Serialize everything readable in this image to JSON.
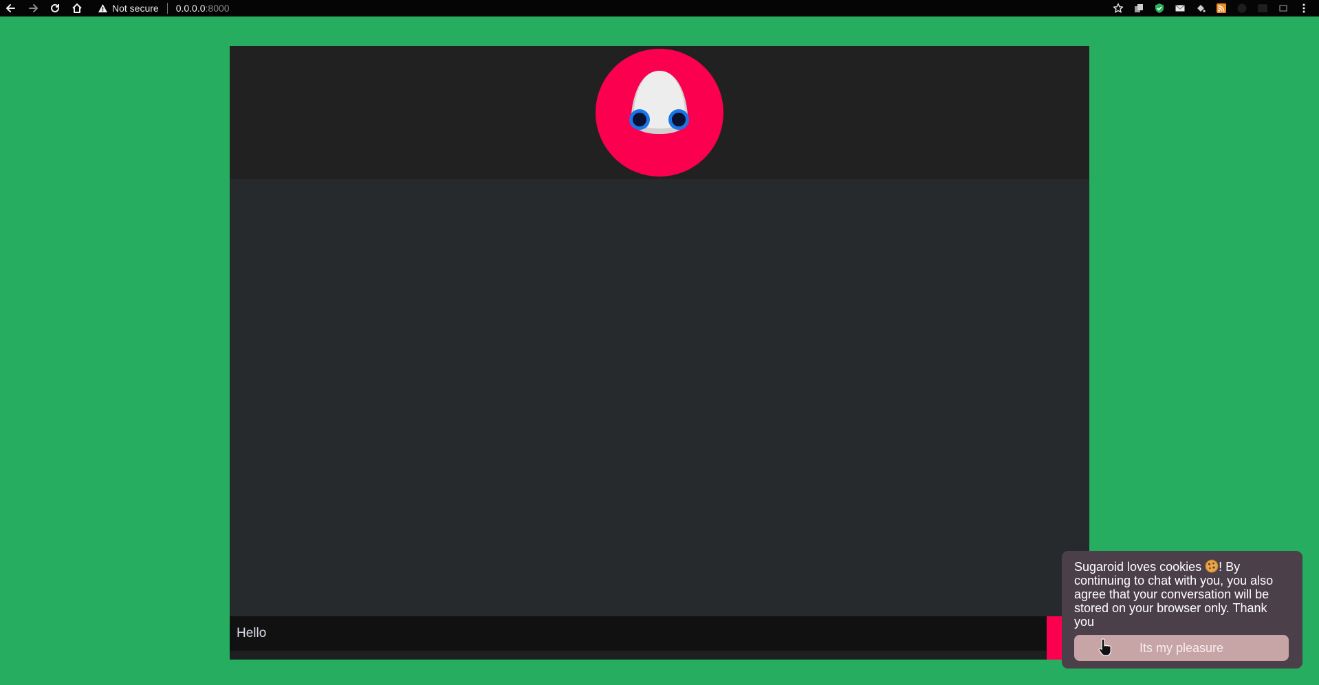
{
  "browser": {
    "security_label": "Not secure",
    "url_host": "0.0.0.0",
    "url_port": ":8000",
    "icons": {
      "back": "arrow-left-icon",
      "forward": "arrow-right-icon",
      "reload": "reload-icon",
      "home": "home-icon",
      "warning": "warning-icon",
      "bookmark": "star-icon",
      "menu": "kebab-menu-icon"
    }
  },
  "chat": {
    "message_input_value": "Hello",
    "send_icon": "send-icon"
  },
  "cookie_popup": {
    "message_before_emoji": "Sugaroid loves cookies ",
    "message_after_emoji": "! By continuing to chat with you, you also agree that your conversation will be stored on your browser only. Thank you",
    "accept_label": "Its my pleasure"
  },
  "colors": {
    "page_background": "#26ad5f",
    "header_background": "#212121",
    "chat_background": "#272a2c",
    "accent": "#fc0050",
    "popup_background": "#4b3f4a",
    "popup_button": "#c7a4a6"
  }
}
